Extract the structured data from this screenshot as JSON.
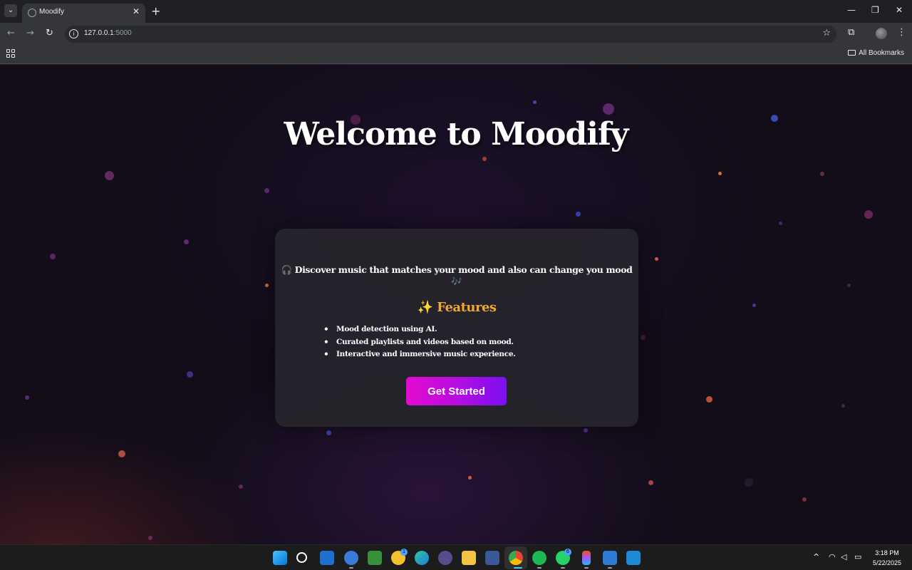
{
  "browser": {
    "tab_title": "Moodify",
    "url_host": "127.0.0.1",
    "url_port": ":5000",
    "all_bookmarks_label": "All Bookmarks"
  },
  "hero": {
    "title": "Welcome to Moodify"
  },
  "card": {
    "tagline_icon": "🎧",
    "tagline": "Discover music that matches your mood and also can change you mood",
    "tagline_end_icon": "🎶",
    "features_icon": "✨",
    "features_title": "Features",
    "features": [
      "Mood detection using AI.",
      "Curated playlists and videos based on mood.",
      "Interactive and immersive music experience."
    ],
    "cta_label": "Get Started"
  },
  "colors": {
    "features_title": "#f0a830",
    "cta_start": "#e40bcf",
    "cta_end": "#7a10f0",
    "page_background": "#120d19",
    "card_background": "#25232b"
  },
  "taskbar": {
    "apps": [
      "windows-start-icon",
      "search-icon",
      "store-icon",
      "qbittorrent-icon",
      "snipping-icon",
      "notes-icon",
      "edge-icon",
      "media-icon",
      "file-explorer-icon",
      "dev-icon",
      "chrome-icon",
      "spotify-icon",
      "whatsapp-icon",
      "figma-icon",
      "remote-icon",
      "vscode-icon"
    ],
    "notes_badge": "1",
    "whatsapp_badge": "6",
    "time": "3:18 PM",
    "date": "5/22/2025"
  }
}
